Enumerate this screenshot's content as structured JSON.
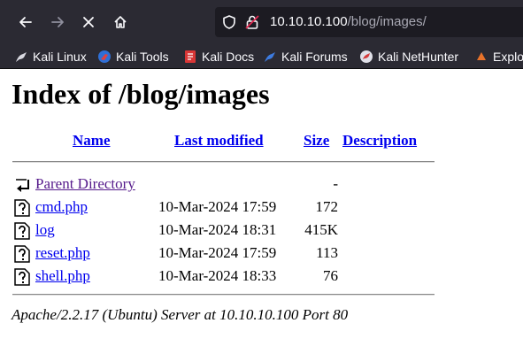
{
  "browser": {
    "url_host": "10.10.10.100",
    "url_path": "/blog/images/",
    "bookmarks": [
      {
        "label": "Kali Linux",
        "icon": "kali-dragon-icon"
      },
      {
        "label": "Kali Tools",
        "icon": "kali-tools-icon"
      },
      {
        "label": "Kali Docs",
        "icon": "kali-docs-icon"
      },
      {
        "label": "Kali Forums",
        "icon": "kali-forums-icon"
      },
      {
        "label": "Kali NetHunter",
        "icon": "kali-nethunter-icon"
      },
      {
        "label": "Exploi",
        "icon": "exploit-db-icon"
      }
    ]
  },
  "page": {
    "title": "Index of /blog/images",
    "columns": {
      "name": "Name",
      "last_modified": "Last modified",
      "size": "Size",
      "description": "Description"
    },
    "parent": {
      "name": "Parent Directory",
      "size": "-"
    },
    "rows": [
      {
        "name": "cmd.php",
        "modified": "10-Mar-2024 17:59",
        "size": "172"
      },
      {
        "name": "log",
        "modified": "10-Mar-2024 18:31",
        "size": "415K"
      },
      {
        "name": "reset.php",
        "modified": "10-Mar-2024 17:59",
        "size": "113"
      },
      {
        "name": "shell.php",
        "modified": "10-Mar-2024 18:33",
        "size": "76"
      }
    ],
    "address": "Apache/2.2.17 (Ubuntu) Server at 10.10.10.100 Port 80"
  },
  "colors": {
    "chrome": "#2b2a33",
    "urlbar": "#1c1b22",
    "link": "#0000ee",
    "visited": "#551a8b"
  }
}
